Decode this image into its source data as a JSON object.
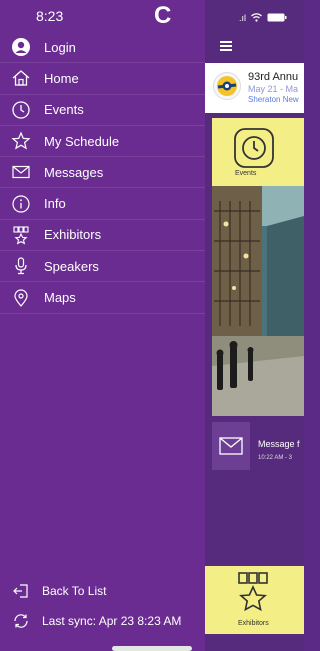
{
  "statusbar": {
    "time": "8:23",
    "signal": ".ıl",
    "wifi": "wifi-icon",
    "battery": "battery-icon"
  },
  "app": {
    "logo_letter": "C"
  },
  "drawer": {
    "items": [
      {
        "label": "Login",
        "icon": "user-icon"
      },
      {
        "label": "Home",
        "icon": "home-icon"
      },
      {
        "label": "Events",
        "icon": "clock-icon"
      },
      {
        "label": "My Schedule",
        "icon": "star-icon"
      },
      {
        "label": "Messages",
        "icon": "envelope-icon"
      },
      {
        "label": "Info",
        "icon": "info-icon"
      },
      {
        "label": "Exhibitors",
        "icon": "exhibitors-icon"
      },
      {
        "label": "Speakers",
        "icon": "microphone-icon"
      },
      {
        "label": "Maps",
        "icon": "map-pin-icon"
      }
    ],
    "back_to_list": "Back To List",
    "last_sync": "Last sync: Apr 23 8:23 AM"
  },
  "main": {
    "event": {
      "title": "93rd Annu",
      "dates": "May 21 - Ma",
      "venue": "Sheraton New"
    },
    "tiles": {
      "events_label": "Events",
      "exhibitors_label": "Exhibitors"
    },
    "message": {
      "text": "Message f",
      "time": "10:22 AM - 3"
    }
  },
  "colors": {
    "drawer_bg": "#6a2c91",
    "main_bg": "#562b7d",
    "tile_yellow": "#f3ee86",
    "date_blue": "#8f96d9"
  }
}
